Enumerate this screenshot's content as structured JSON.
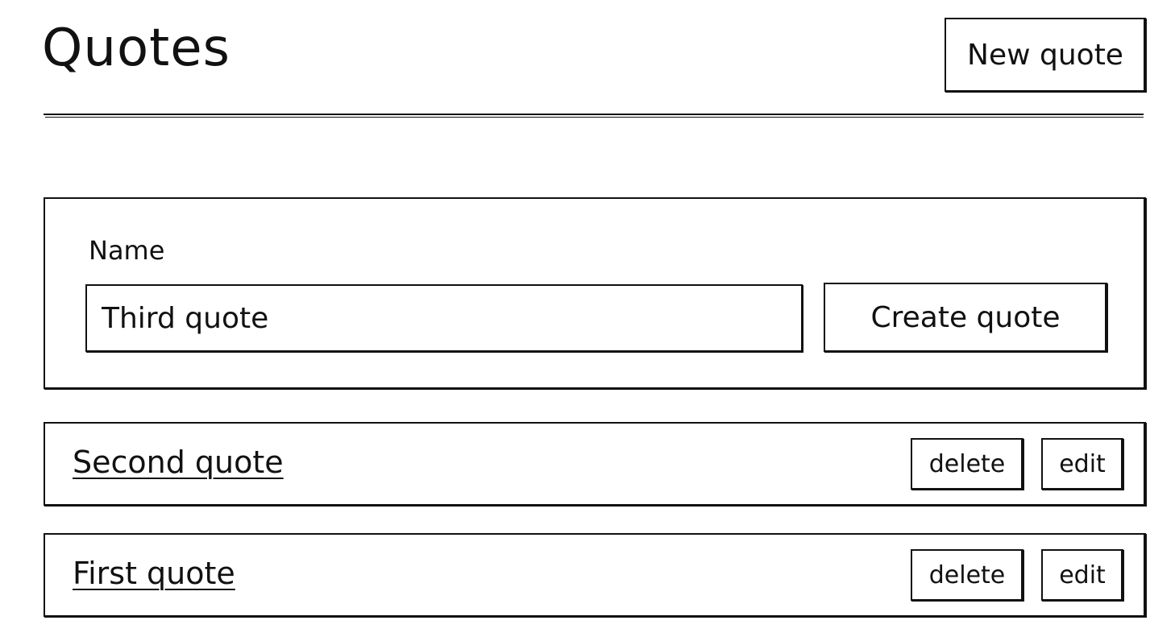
{
  "header": {
    "title": "Quotes",
    "new_quote_label": "New quote"
  },
  "form": {
    "name_label": "Name",
    "name_value": "Third quote",
    "submit_label": "Create quote"
  },
  "quotes": [
    {
      "name": "Second quote",
      "delete_label": "delete",
      "edit_label": "edit"
    },
    {
      "name": "First quote",
      "delete_label": "delete",
      "edit_label": "edit"
    }
  ]
}
